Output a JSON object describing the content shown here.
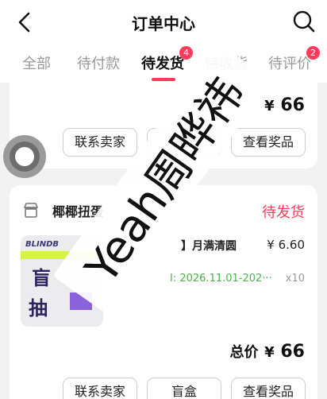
{
  "header": {
    "title": "订单中心"
  },
  "tabs": [
    {
      "label": "全部",
      "badge": null
    },
    {
      "label": "待付款",
      "badge": null
    },
    {
      "label": "待发货",
      "badge": "4"
    },
    {
      "label": "待收货",
      "badge": null
    },
    {
      "label": "待评价",
      "badge": "2"
    }
  ],
  "orders": [
    {
      "total_label": "",
      "currency": "¥",
      "total": "66",
      "buttons": [
        "联系卖家",
        "盲盒",
        "查看奖品"
      ]
    },
    {
      "shop_name": "椰椰扭蛋",
      "status": "待发货",
      "product": {
        "thumb_brand": "BLINDB",
        "thumb_text_1": "盲",
        "thumb_text_2": "抽",
        "name": "】月满清圆",
        "price": "¥ 6.60",
        "date": "I: 2026.11.01-202···",
        "qty": "x10"
      },
      "total_label": "总价",
      "currency": "¥",
      "total": "66",
      "buttons": [
        "联系卖家",
        "盲盒",
        "查看奖品"
      ]
    }
  ],
  "watermark": "Yeah周晔祎",
  "colors": {
    "accent": "#ff3b5c",
    "date_green": "#4caf50"
  }
}
